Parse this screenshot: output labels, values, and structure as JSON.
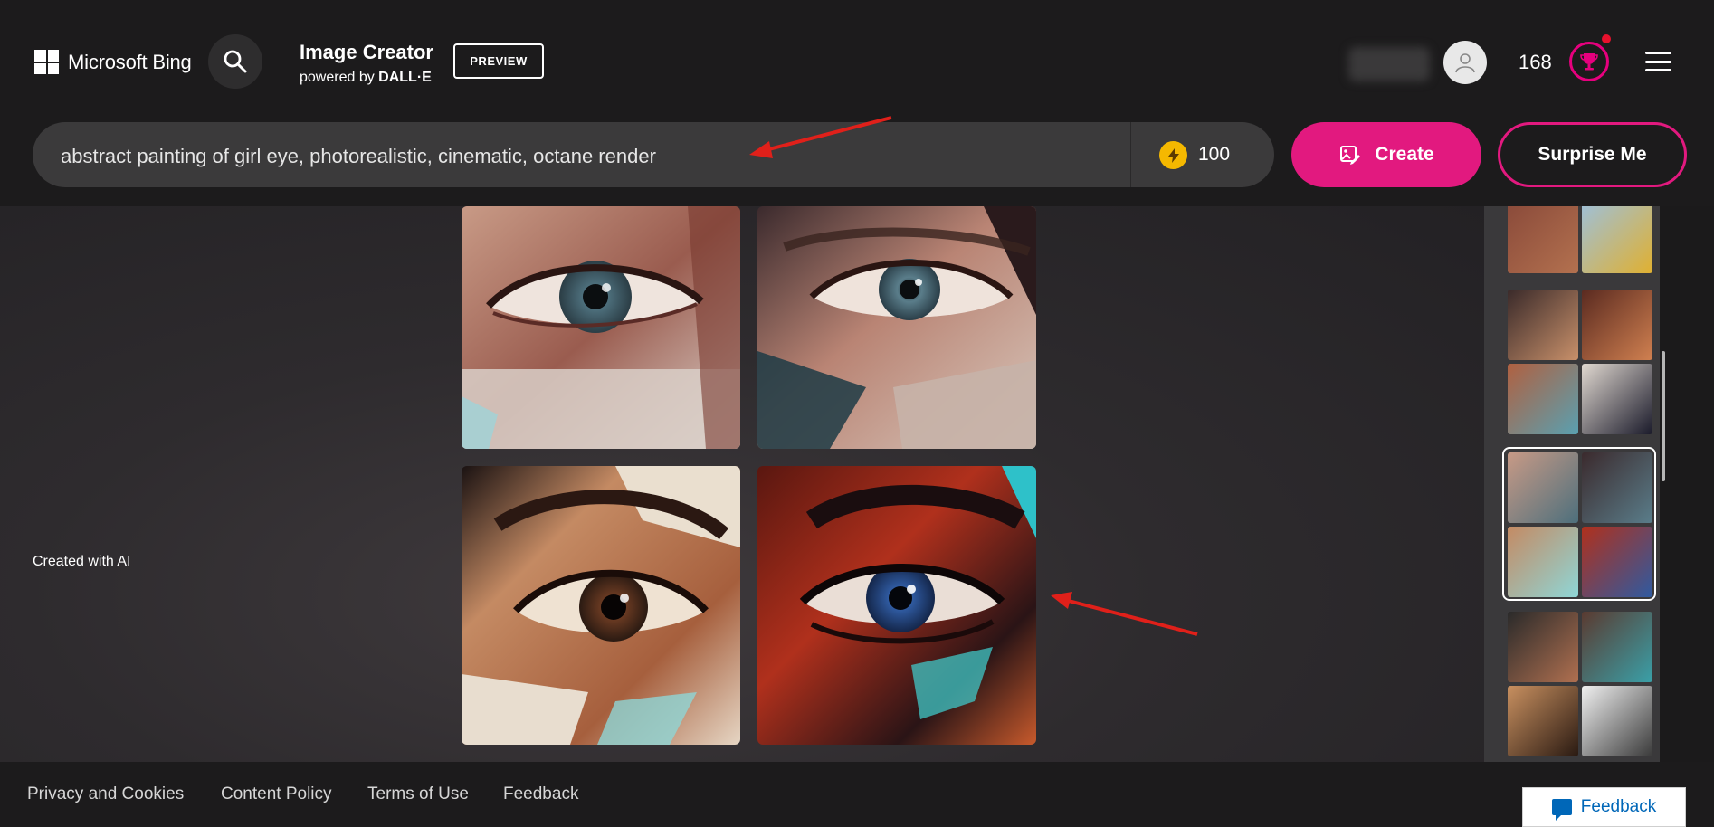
{
  "header": {
    "brand": "Microsoft Bing",
    "app_title": "Image Creator",
    "powered_by_prefix": "powered by",
    "powered_by_name": "DALL·E",
    "badge": "PREVIEW",
    "points": "168"
  },
  "prompt": {
    "text": "abstract painting of girl eye, photorealistic, cinematic, octane render",
    "boosts": "100"
  },
  "actions": {
    "create": "Create",
    "surprise": "Surprise Me"
  },
  "main": {
    "caption": "Created with AI"
  },
  "footer": {
    "links": [
      "Privacy and Cookies",
      "Content Policy",
      "Terms of Use",
      "Feedback"
    ],
    "feedback_button": "Feedback"
  },
  "colors": {
    "accent": "#e2197f",
    "boost_coin": "#f5b800",
    "feedback_blue": "#0067b8"
  },
  "icons": [
    "microsoft-logo",
    "search-icon",
    "user-icon",
    "trophy-icon",
    "hamburger-menu-icon",
    "bolt-icon",
    "create-image-icon",
    "feedback-icon",
    "arrow-icon"
  ]
}
